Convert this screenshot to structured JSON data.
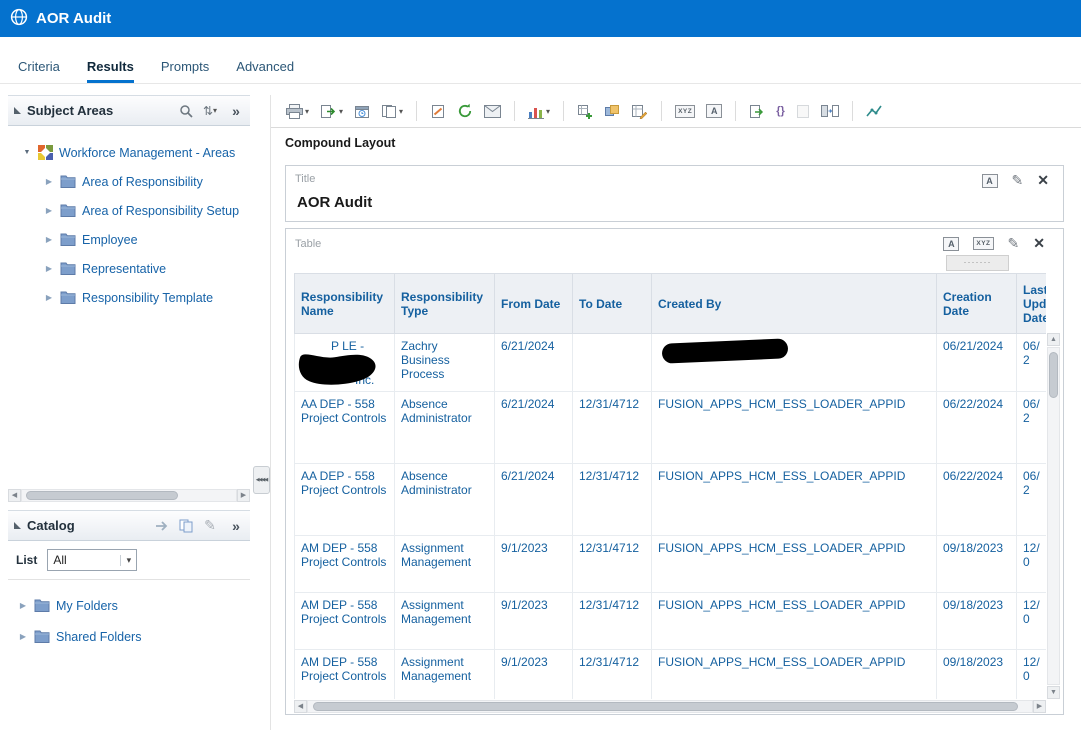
{
  "app": {
    "title": "AOR Audit"
  },
  "colors": {
    "topbar": "#0572ce",
    "tab_underline": "#0572ce",
    "link_text": "#15609f",
    "tree_text": "#1763a8"
  },
  "tabs": {
    "items": [
      {
        "label": "Criteria"
      },
      {
        "label": "Results"
      },
      {
        "label": "Prompts"
      },
      {
        "label": "Advanced"
      }
    ],
    "active": "Results"
  },
  "subject_areas": {
    "title": "Subject Areas",
    "root_label": "Workforce Management - Areas",
    "items": [
      "Area of Responsibility",
      "Area of Responsibility Setup",
      "Employee",
      "Representative",
      "Responsibility Template"
    ]
  },
  "catalog": {
    "title": "Catalog",
    "list_label": "List",
    "list_value": "All",
    "items": [
      "My Folders",
      "Shared Folders"
    ]
  },
  "toolbar": {
    "buttons": [
      "print",
      "export",
      "schedule",
      "copy",
      "import-formatting",
      "refresh",
      "email",
      "new-view",
      "new-calculated-measure",
      "new-group",
      "new-calculated-item",
      "selection-steps",
      "format-container",
      "copy-formatting",
      "apply-formatting",
      "clear-formatting",
      "compare-layout",
      "advanced-options"
    ]
  },
  "results": {
    "compound_layout_label": "Compound Layout",
    "title_view": {
      "label": "Title",
      "heading": "AOR Audit"
    },
    "table_view": {
      "label": "Table"
    }
  },
  "table": {
    "columns": [
      "Responsibility Name",
      "Responsibility Type",
      "From Date",
      "To Date",
      "Created By",
      "Creation Date",
      "Last Updated Date"
    ],
    "rows": [
      {
        "name": "P LE -",
        "name2": "Inc.",
        "name_redacted": true,
        "type": "Zachry Business Process",
        "from": "6/21/2024",
        "to": "",
        "created_by": "",
        "created_by_redacted": true,
        "created": "06/21/2024",
        "updated": "06/2"
      },
      {
        "name": "AA DEP - 558 Project Controls",
        "name2": "",
        "type": "Absence Administrator",
        "from": "6/21/2024",
        "to": "12/31/4712",
        "created_by": "FUSION_APPS_HCM_ESS_LOADER_APPID",
        "created": "06/22/2024",
        "updated": "06/2"
      },
      {
        "name": "AA DEP - 558 Project Controls",
        "name2": "",
        "type": "Absence Administrator",
        "from": "6/21/2024",
        "to": "12/31/4712",
        "created_by": "FUSION_APPS_HCM_ESS_LOADER_APPID",
        "created": "06/22/2024",
        "updated": "06/2"
      },
      {
        "name": "AM DEP - 558 Project Controls",
        "name2": "",
        "type": "Assignment Management",
        "from": "9/1/2023",
        "to": "12/31/4712",
        "created_by": "FUSION_APPS_HCM_ESS_LOADER_APPID",
        "created": "09/18/2023",
        "updated": "12/0"
      },
      {
        "name": "AM DEP - 558 Project Controls",
        "name2": "",
        "type": "Assignment Management",
        "from": "9/1/2023",
        "to": "12/31/4712",
        "created_by": "FUSION_APPS_HCM_ESS_LOADER_APPID",
        "created": "09/18/2023",
        "updated": "12/0"
      },
      {
        "name": "AM DEP - 558 Project Controls",
        "name2": "",
        "type": "Assignment Management",
        "from": "9/1/2023",
        "to": "12/31/4712",
        "created_by": "FUSION_APPS_HCM_ESS_LOADER_APPID",
        "created": "09/18/2023",
        "updated": "12/0"
      }
    ]
  },
  "icons": {
    "dropdown": "▾",
    "pencil": "✎",
    "close": "✕",
    "more": "»",
    "sort": "⇅",
    "caret": "▶",
    "caret_open": "▼",
    "left": "◀",
    "right": "▶",
    "up": "▲",
    "down": "▼",
    "xyz": "XYZ",
    "a": "A",
    "dots": "·······",
    "braces": "{}",
    "collapse_handle": "◀◀◀◀"
  }
}
